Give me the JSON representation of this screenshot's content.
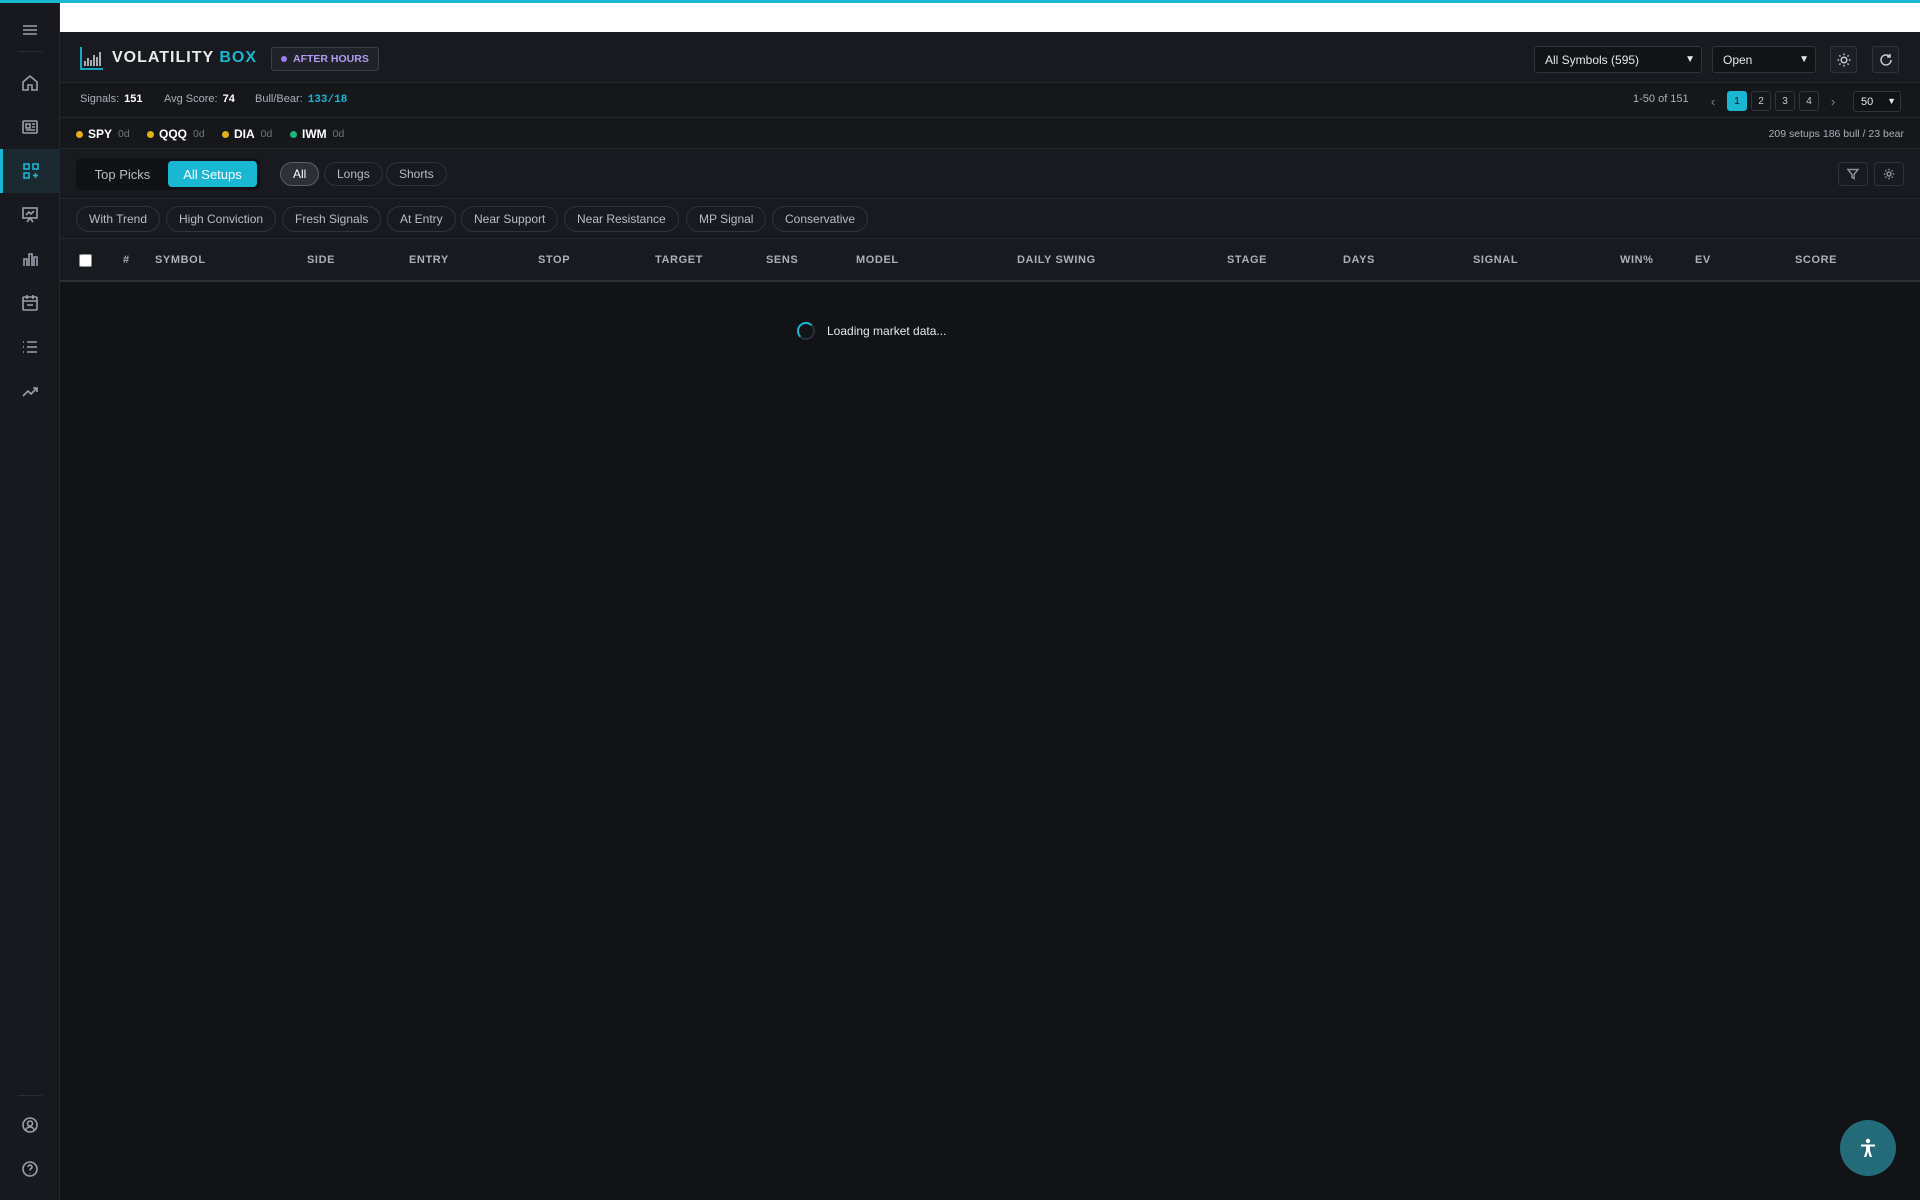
{
  "app": {
    "logo_word1": "VOLATILITY",
    "logo_word2": "BOX",
    "status_badge": "AFTER HOURS",
    "accent_color": "#19b7d2"
  },
  "sidebar": {
    "items": [
      {
        "icon": "menu-icon"
      },
      {
        "icon": "home-icon"
      },
      {
        "icon": "news-icon"
      },
      {
        "icon": "scanner-icon",
        "active": true
      },
      {
        "icon": "presentation-chart-icon"
      },
      {
        "icon": "bar-chart-icon"
      },
      {
        "icon": "calendar-icon"
      },
      {
        "icon": "list-icon"
      },
      {
        "icon": "trending-up-icon"
      },
      {
        "icon": "user-circle-icon"
      },
      {
        "icon": "help-icon"
      }
    ]
  },
  "header": {
    "symbols_select": "All Symbols (595)",
    "status_select": "Open",
    "theme_button_icon": "sun-icon",
    "refresh_button_icon": "refresh-icon"
  },
  "stats": {
    "signals_label": "Signals:",
    "signals_value": "151",
    "avg_score_label": "Avg Score:",
    "avg_score_value": "74",
    "bull_bear_label": "Bull/Bear:",
    "bull_bear_value": "133/18",
    "range": "1-50 of 151",
    "prev": "‹",
    "pages": [
      "1",
      "2",
      "3",
      "4"
    ],
    "current_page": "1",
    "next": "›",
    "per_page": "50"
  },
  "indices": [
    {
      "symbol": "SPY",
      "change": "0d",
      "color": "#e2b21b"
    },
    {
      "symbol": "QQQ",
      "change": "0d",
      "color": "#e2b21b"
    },
    {
      "symbol": "DIA",
      "change": "0d",
      "color": "#e2b21b"
    },
    {
      "symbol": "IWM",
      "change": "0d",
      "color": "#1fb57a"
    }
  ],
  "setups_summary": "209 setups 186 bull / 23 bear",
  "tabs": {
    "top_picks": "Top Picks",
    "all_setups": "All Setups",
    "filters": [
      "All",
      "Longs",
      "Shorts"
    ],
    "active_filter": "All"
  },
  "presets": [
    "With Trend",
    "High Conviction",
    "Fresh Signals",
    "At Entry",
    "Near Support",
    "Near Resistance",
    "MP Signal",
    "Conservative"
  ],
  "table": {
    "columns": [
      "#",
      "SYMBOL",
      "SIDE",
      "ENTRY",
      "STOP",
      "TARGET",
      "SENS",
      "MODEL",
      "DAILY SWING",
      "STAGE",
      "DAYS",
      "SIGNAL",
      "WIN%",
      "EV",
      "SCORE"
    ]
  },
  "loading_text": "Loading market data...",
  "fab_icon": "accessibility-icon"
}
